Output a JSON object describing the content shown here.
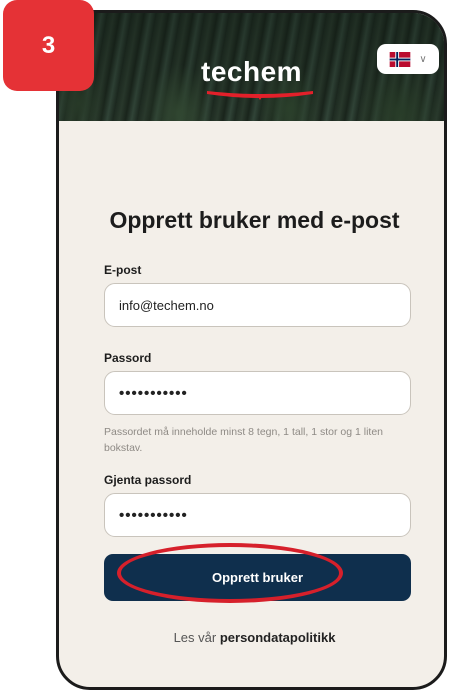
{
  "step_badge": "3",
  "header": {
    "logo_text": "techem"
  },
  "page_title": "Opprett bruker med e-post",
  "email": {
    "label": "E-post",
    "value": "info@techem.no"
  },
  "password": {
    "label": "Passord",
    "masked_value": "•••••••••••",
    "hint": "Passordet må inneholde minst 8 tegn, 1 tall, 1 stor og 1 liten bokstav."
  },
  "confirm_password": {
    "label": "Gjenta passord",
    "masked_value": "•••••••••••"
  },
  "submit": {
    "label": "Opprett bruker"
  },
  "footer": {
    "prefix": "Les vår",
    "link": "persondatapolitikk"
  },
  "colors": {
    "button": "#0f2f4d",
    "accent": "#e53236",
    "background": "#f3efe9"
  }
}
